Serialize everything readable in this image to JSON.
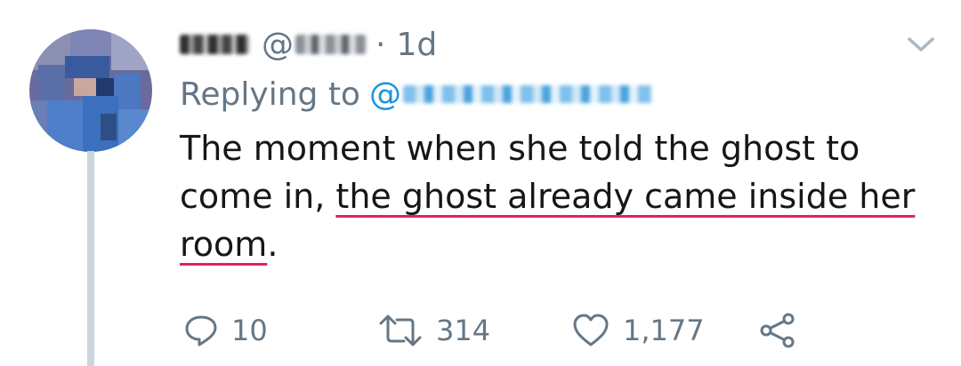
{
  "tweet": {
    "author_at": "@",
    "time_separator": "·",
    "time": "1d",
    "replying_label": "Replying to",
    "reply_at": "@",
    "text_line1": "The moment when she told the ghost to",
    "text_line2_start": "come in, ",
    "text_line2_underlined": "the ghost already came inside her",
    "text_line3_underlined": "room",
    "text_line3_end": ".",
    "reply_count": "10",
    "retweet_count": "314",
    "like_count": "1,177"
  },
  "colors": {
    "secondary_text": "#657786",
    "link_blue": "#1b95e0",
    "spellcheck_red": "#e0245e",
    "thread_line": "#ccd6dd"
  },
  "icons": {
    "more": "chevron-down-icon",
    "reply": "reply-icon",
    "retweet": "retweet-icon",
    "like": "heart-icon",
    "share": "share-icon"
  }
}
